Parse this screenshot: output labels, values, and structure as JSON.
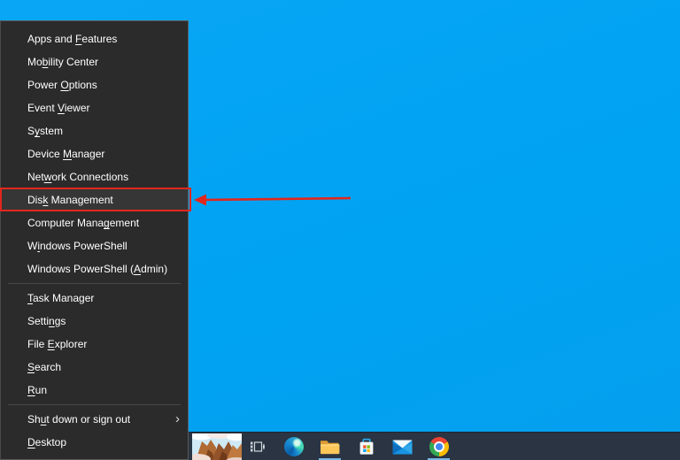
{
  "desktop": {
    "background_color": "#00a2f2"
  },
  "menu": {
    "submenu_chevron": "›",
    "items": [
      {
        "id": "apps-and-features",
        "pre": "Apps and ",
        "key": "F",
        "post": "eatures"
      },
      {
        "id": "mobility-center",
        "pre": "Mo",
        "key": "b",
        "post": "ility Center"
      },
      {
        "id": "power-options",
        "pre": "Power ",
        "key": "O",
        "post": "ptions"
      },
      {
        "id": "event-viewer",
        "pre": "Event ",
        "key": "V",
        "post": "iewer"
      },
      {
        "id": "system",
        "pre": "S",
        "key": "y",
        "post": "stem"
      },
      {
        "id": "device-manager",
        "pre": "Device ",
        "key": "M",
        "post": "anager"
      },
      {
        "id": "network-connections",
        "pre": "Net",
        "key": "w",
        "post": "ork Connections"
      },
      {
        "id": "disk-management",
        "pre": "Dis",
        "key": "k",
        "post": " Management",
        "highlighted": true
      },
      {
        "id": "computer-management",
        "pre": "Computer Mana",
        "key": "g",
        "post": "ement"
      },
      {
        "id": "windows-powershell",
        "pre": "W",
        "key": "i",
        "post": "ndows PowerShell"
      },
      {
        "id": "windows-powershell-admin",
        "pre": "Windows PowerShell (",
        "key": "A",
        "post": "dmin)"
      },
      {
        "type": "separator"
      },
      {
        "id": "task-manager",
        "pre": "",
        "key": "T",
        "post": "ask Manager"
      },
      {
        "id": "settings",
        "pre": "Setti",
        "key": "n",
        "post": "gs"
      },
      {
        "id": "file-explorer",
        "pre": "File ",
        "key": "E",
        "post": "xplorer"
      },
      {
        "id": "search",
        "pre": "",
        "key": "S",
        "post": "earch"
      },
      {
        "id": "run",
        "pre": "",
        "key": "R",
        "post": "un"
      },
      {
        "type": "separator"
      },
      {
        "id": "shut-down-or-sign-out",
        "pre": "Sh",
        "key": "u",
        "post": "t down or sign out",
        "has_submenu": true
      },
      {
        "id": "desktop",
        "pre": "",
        "key": "D",
        "post": "esktop"
      }
    ]
  },
  "annotation": {
    "color": "#e2271c",
    "highlight_target": "Disk Management",
    "shapes": [
      "rectangle-outline",
      "left-pointing-arrow"
    ]
  },
  "taskbar": {
    "bar_color": "#2a3442",
    "open_indicator_color": "#79b8e8",
    "search_highlight_image": "canyon-and-clouds-artwork",
    "icons": [
      {
        "name": "task-view-icon",
        "open": false
      },
      {
        "name": "microsoft-edge-icon",
        "open": false
      },
      {
        "name": "file-explorer-icon",
        "open": true
      },
      {
        "name": "microsoft-store-icon",
        "open": false
      },
      {
        "name": "mail-icon",
        "open": false
      },
      {
        "name": "google-chrome-icon",
        "open": true
      }
    ]
  }
}
